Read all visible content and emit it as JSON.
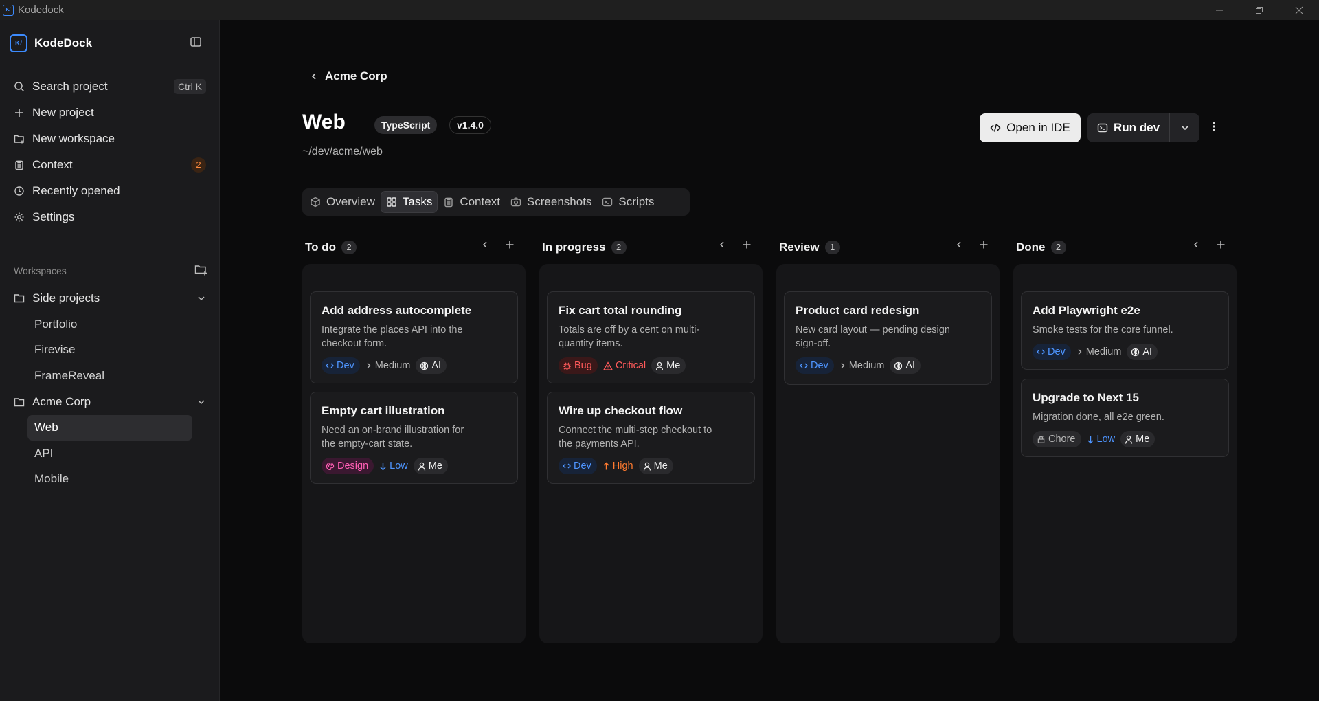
{
  "window": {
    "app_title": "Kodedock"
  },
  "sidebar": {
    "brand": "KodeDock",
    "nav": [
      {
        "label": "Search project",
        "icon": "search-icon",
        "shortcut": "Ctrl K"
      },
      {
        "label": "New project",
        "icon": "plus-icon"
      },
      {
        "label": "New workspace",
        "icon": "folder-plus-icon"
      },
      {
        "label": "Context",
        "icon": "clipboard-icon",
        "badge": "2"
      },
      {
        "label": "Recently opened",
        "icon": "clock-icon"
      },
      {
        "label": "Settings",
        "icon": "gear-icon"
      }
    ],
    "workspaces_label": "Workspaces",
    "workspaces": [
      {
        "label": "Side projects",
        "expanded": true,
        "children": [
          "Portfolio",
          "Firevise",
          "FrameReveal"
        ]
      },
      {
        "label": "Acme Corp",
        "expanded": true,
        "children": [
          "Web",
          "API",
          "Mobile"
        ],
        "active_child": "Web"
      }
    ]
  },
  "main": {
    "breadcrumb": "Acme Corp",
    "title": "Web",
    "language": "TypeScript",
    "version": "v1.4.0",
    "path": "~/dev/acme/web",
    "actions": {
      "open_ide": "Open in IDE",
      "run_dev": "Run dev"
    },
    "tabs": [
      {
        "label": "Overview",
        "icon": "box-icon"
      },
      {
        "label": "Tasks",
        "icon": "grid-icon",
        "active": true
      },
      {
        "label": "Context",
        "icon": "clipboard-icon"
      },
      {
        "label": "Screenshots",
        "icon": "camera-icon"
      },
      {
        "label": "Scripts",
        "icon": "terminal-icon"
      }
    ],
    "columns": [
      {
        "title": "To do",
        "count": "2",
        "cards": [
          {
            "title": "Add address autocomplete",
            "desc": "Integrate the places API into the checkout form.",
            "tags": [
              [
                "dev",
                "Dev"
              ],
              [
                "plain",
                "Medium"
              ],
              [
                "user",
                "AI"
              ]
            ]
          },
          {
            "title": "Empty cart illustration",
            "desc": "Need an on-brand illustration for the empty-cart state.",
            "tags": [
              [
                "design",
                "Design"
              ],
              [
                "low",
                "Low"
              ],
              [
                "user",
                "Me"
              ]
            ]
          }
        ]
      },
      {
        "title": "In progress",
        "count": "2",
        "cards": [
          {
            "title": "Fix cart total rounding",
            "desc": "Totals are off by a cent on multi-quantity items.",
            "tags": [
              [
                "bug",
                "Bug"
              ],
              [
                "crit",
                "Critical"
              ],
              [
                "user",
                "Me"
              ]
            ]
          },
          {
            "title": "Wire up checkout flow",
            "desc": "Connect the multi-step checkout to the payments API.",
            "tags": [
              [
                "dev",
                "Dev"
              ],
              [
                "high",
                "High"
              ],
              [
                "user",
                "Me"
              ]
            ]
          }
        ]
      },
      {
        "title": "Review",
        "count": "1",
        "cards": [
          {
            "title": "Product card redesign",
            "desc": "New card layout — pending design sign-off.",
            "tags": [
              [
                "dev",
                "Dev"
              ],
              [
                "plain",
                "Medium"
              ],
              [
                "user",
                "AI"
              ]
            ]
          }
        ]
      },
      {
        "title": "Done",
        "count": "2",
        "cards": [
          {
            "title": "Add Playwright e2e",
            "desc": "Smoke tests for the core funnel.",
            "tags": [
              [
                "dev",
                "Dev"
              ],
              [
                "plain",
                "Medium"
              ],
              [
                "user",
                "AI"
              ]
            ]
          },
          {
            "title": "Upgrade to Next 15",
            "desc": "Migration done, all e2e green.",
            "tags": [
              [
                "chore",
                "Chore"
              ],
              [
                "low",
                "Low"
              ],
              [
                "user",
                "Me"
              ]
            ]
          }
        ]
      }
    ]
  },
  "colors": {
    "accent": "#3d8bfd",
    "bug": "#ff5a5a",
    "design": "#ff5fb4",
    "high": "#ff7a2f",
    "badge": "#ff8a3d"
  }
}
